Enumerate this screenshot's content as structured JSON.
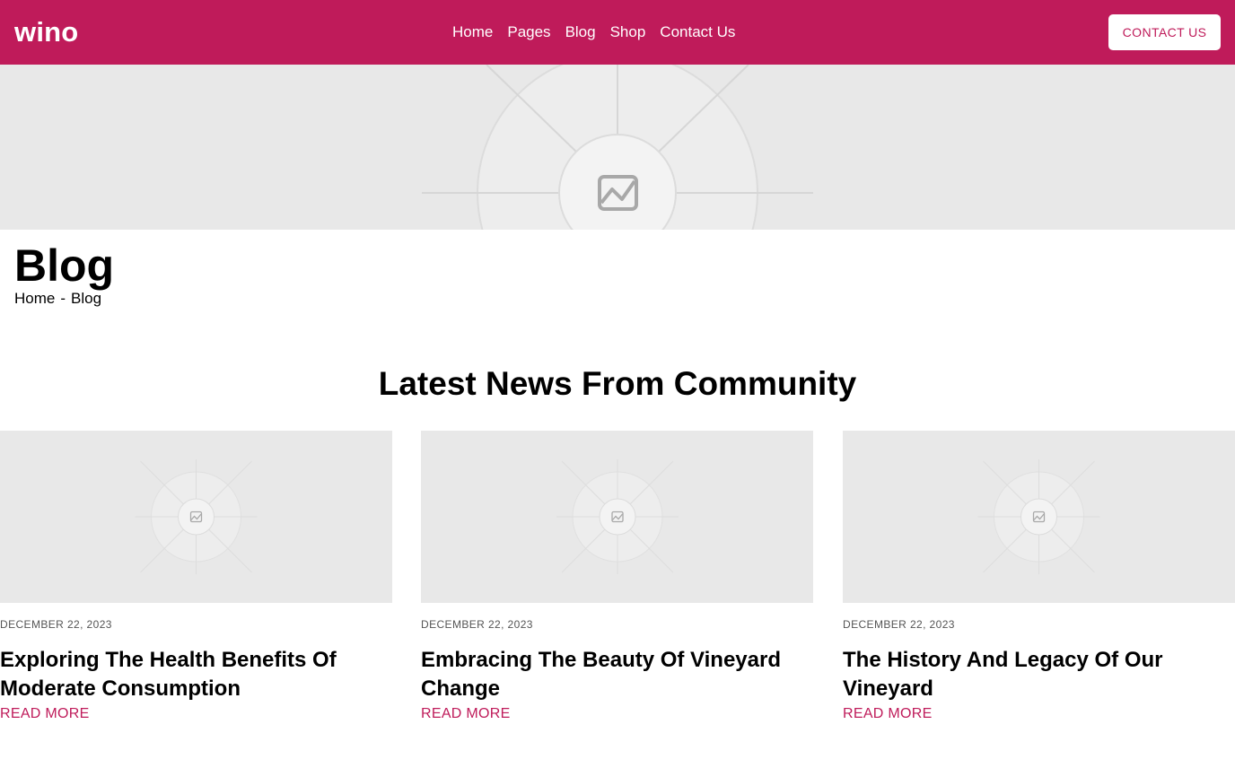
{
  "header": {
    "logo": "wino",
    "nav": [
      "Home",
      "Pages",
      "Blog",
      "Shop",
      "Contact Us"
    ],
    "cta_label": "CONTACT US"
  },
  "hero": {
    "image": "image-placeholder-icon"
  },
  "page": {
    "title": "Blog",
    "breadcrumb": {
      "home": "Home",
      "separator": "-",
      "current": "Blog"
    }
  },
  "section": {
    "title": "Latest News From Community"
  },
  "posts": [
    {
      "date": "DECEMBER 22, 2023",
      "title": "Exploring The Health Benefits Of Moderate Consumption",
      "link": "READ MORE"
    },
    {
      "date": "DECEMBER 22, 2023",
      "title": "Embracing The Beauty Of Vineyard Change",
      "link": "READ MORE"
    },
    {
      "date": "DECEMBER 22, 2023",
      "title": "The History And Legacy Of Our Vineyard",
      "link": "READ MORE"
    }
  ],
  "colors": {
    "brand": "#bf1b5a",
    "placeholder_bg": "#e8e8e8"
  }
}
